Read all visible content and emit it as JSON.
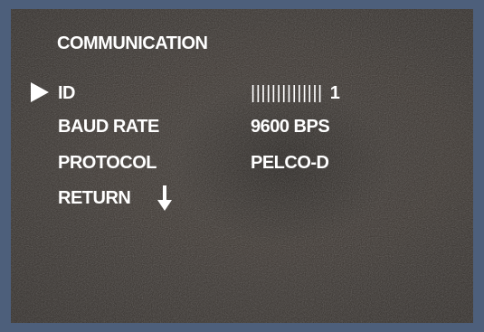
{
  "menu": {
    "title": "COMMUNICATION",
    "items": [
      {
        "label": "ID",
        "value": "1",
        "bar": "||||||||||||||"
      },
      {
        "label": "BAUD RATE",
        "value": "9600 BPS"
      },
      {
        "label": "PROTOCOL",
        "value": "PELCO-D"
      },
      {
        "label": "RETURN"
      }
    ],
    "cursor_icon": "triangle-right-icon",
    "return_icon": "arrow-down-icon"
  },
  "colors": {
    "frame": "#4d5f7b",
    "text": "#ffffff",
    "background": "#3a3430"
  }
}
